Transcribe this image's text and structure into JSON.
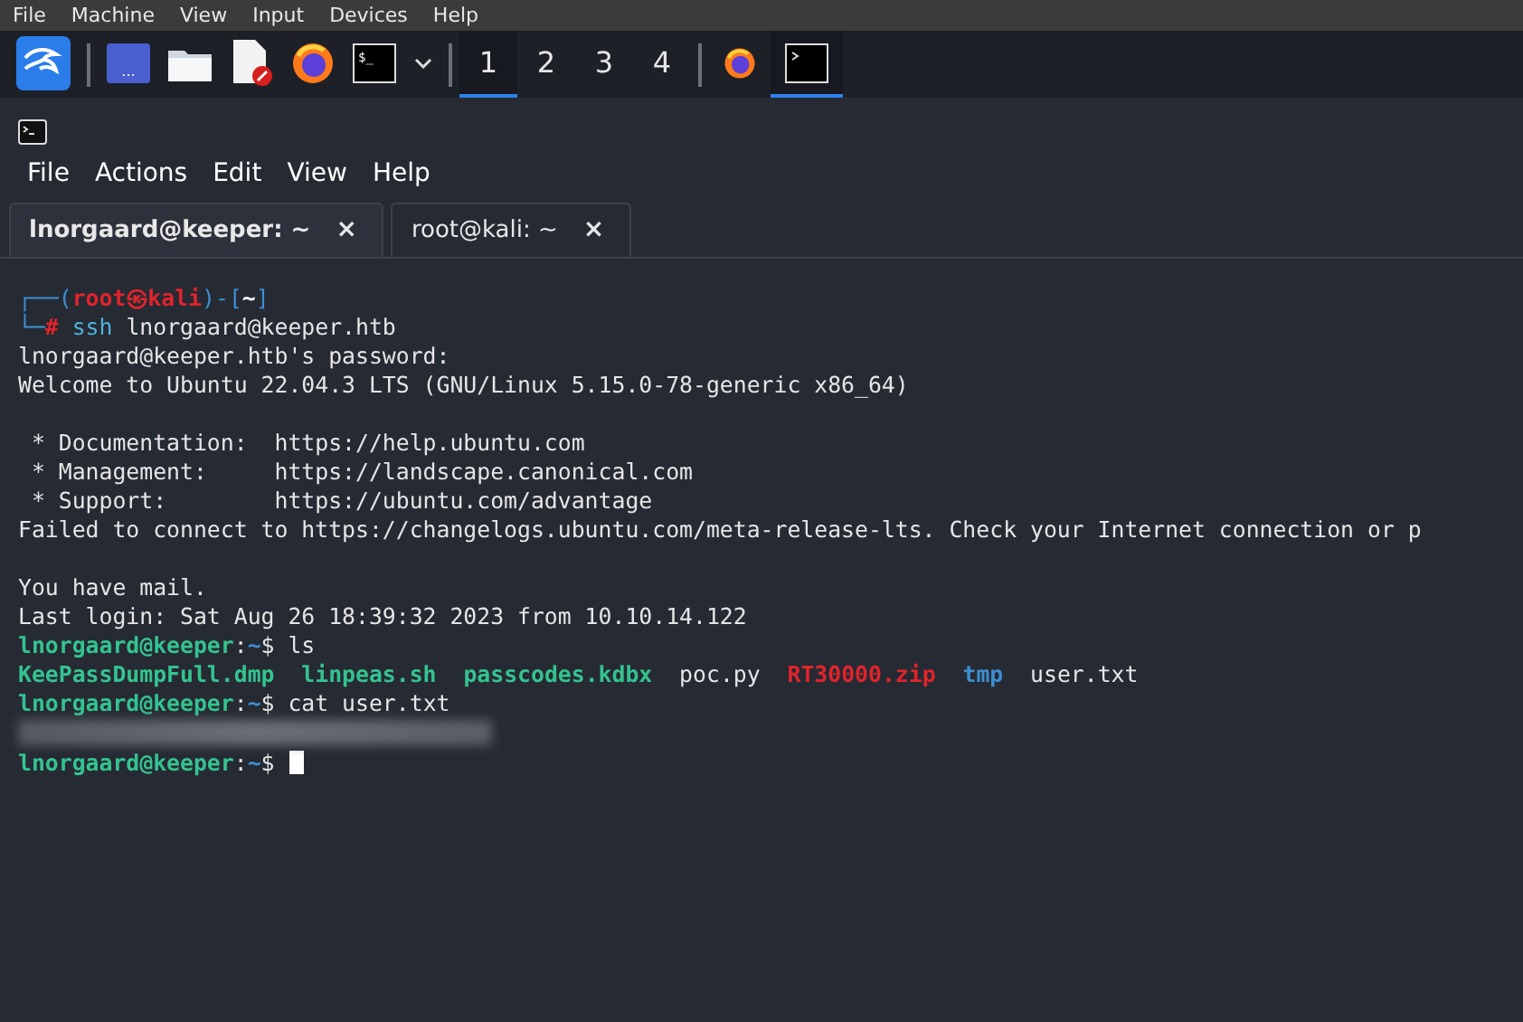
{
  "host_menu": [
    "File",
    "Machine",
    "View",
    "Input",
    "Devices",
    "Help"
  ],
  "taskbar": {
    "launchers": [
      {
        "kind": "kali"
      },
      {
        "kind": "desktop",
        "label": "..."
      },
      {
        "kind": "folder"
      },
      {
        "kind": "editor"
      },
      {
        "kind": "firefox"
      },
      {
        "kind": "terminal",
        "label": "$_"
      },
      {
        "kind": "caret"
      }
    ],
    "workspaces": [
      {
        "label": "1",
        "selected": true
      },
      {
        "label": "2",
        "selected": false
      },
      {
        "label": "3",
        "selected": false
      },
      {
        "label": "4",
        "selected": false
      }
    ],
    "windows": [
      {
        "kind": "firefox",
        "selected": false
      },
      {
        "kind": "terminal",
        "selected": true
      }
    ]
  },
  "terminal": {
    "menu": [
      "File",
      "Actions",
      "Edit",
      "View",
      "Help"
    ],
    "tabs": [
      {
        "label": "lnorgaard@keeper: ~",
        "close": "×",
        "selected": true
      },
      {
        "label": "root@kali: ~",
        "close": "×",
        "selected": false
      }
    ],
    "lines": [
      {
        "kind": "text",
        "segments": [
          {
            "text": "┌──(",
            "kind": "frame"
          },
          {
            "text": "root㉿kali",
            "kind": "root"
          },
          {
            "text": ")-[",
            "kind": "frame"
          },
          {
            "text": "~",
            "kind": "bold"
          },
          {
            "text": "]",
            "kind": "frame"
          }
        ]
      },
      {
        "kind": "text",
        "segments": [
          {
            "text": "└─",
            "kind": "frame"
          },
          {
            "text": "#",
            "kind": "root"
          },
          {
            "text": " ssh",
            "kind": "cmd"
          },
          {
            "text": " lnorgaard@keeper.htb",
            "kind": "plain"
          }
        ]
      },
      {
        "kind": "text",
        "segments": [
          {
            "text": "lnorgaard@keeper.htb's password:",
            "kind": "plain"
          }
        ]
      },
      {
        "kind": "text",
        "segments": [
          {
            "text": "Welcome to Ubuntu 22.04.3 LTS (GNU/Linux 5.15.0-78-generic x86_64)",
            "kind": "plain"
          }
        ]
      },
      {
        "kind": "blank"
      },
      {
        "kind": "text",
        "segments": [
          {
            "text": " * Documentation:  https://help.ubuntu.com",
            "kind": "plain"
          }
        ]
      },
      {
        "kind": "text",
        "segments": [
          {
            "text": " * Management:     https://landscape.canonical.com",
            "kind": "plain"
          }
        ]
      },
      {
        "kind": "text",
        "segments": [
          {
            "text": " * Support:        https://ubuntu.com/advantage",
            "kind": "plain"
          }
        ]
      },
      {
        "kind": "text",
        "segments": [
          {
            "text": "Failed to connect to https://changelogs.ubuntu.com/meta-release-lts. Check your Internet connection or p",
            "kind": "plain"
          }
        ]
      },
      {
        "kind": "blank"
      },
      {
        "kind": "text",
        "segments": [
          {
            "text": "You have mail.",
            "kind": "plain"
          }
        ]
      },
      {
        "kind": "text",
        "segments": [
          {
            "text": "Last login: Sat Aug 26 18:39:32 2023 from 10.10.14.122",
            "kind": "plain"
          }
        ]
      },
      {
        "kind": "text",
        "segments": [
          {
            "text": "lnorgaard@keeper",
            "kind": "user"
          },
          {
            "text": ":",
            "kind": "plain"
          },
          {
            "text": "~",
            "kind": "dir"
          },
          {
            "text": "$ ls",
            "kind": "plain"
          }
        ]
      },
      {
        "kind": "text",
        "segments": [
          {
            "text": "KeePassDumpFull.dmp",
            "kind": "exec"
          },
          {
            "text": "  linpeas.sh",
            "kind": "exec"
          },
          {
            "text": "  passcodes.kdbx",
            "kind": "exec"
          },
          {
            "text": "  poc.py",
            "kind": "plain"
          },
          {
            "text": "  RT30000.zip",
            "kind": "archive"
          },
          {
            "text": "  tmp",
            "kind": "dir"
          },
          {
            "text": "  user.txt",
            "kind": "plain"
          }
        ]
      },
      {
        "kind": "text",
        "segments": [
          {
            "text": "lnorgaard@keeper",
            "kind": "user"
          },
          {
            "text": ":",
            "kind": "plain"
          },
          {
            "text": "~",
            "kind": "dir"
          },
          {
            "text": "$ cat user.txt",
            "kind": "plain"
          }
        ]
      },
      {
        "kind": "redacted"
      },
      {
        "kind": "text",
        "cursor": true,
        "segments": [
          {
            "text": "lnorgaard@keeper",
            "kind": "user"
          },
          {
            "text": ":",
            "kind": "plain"
          },
          {
            "text": "~",
            "kind": "dir"
          },
          {
            "text": "$",
            "kind": "plain"
          }
        ]
      }
    ]
  }
}
